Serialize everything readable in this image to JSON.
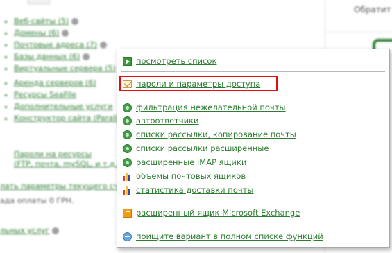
{
  "background": {
    "right_text": "Обратит",
    "list_items": [
      "Веб-сайты (5)",
      "Домены (6)",
      "Почтовые адреса (7)",
      "Базы данных (6)",
      "Виртуальные сервера (5)",
      "Аренда серверов (6)",
      "Ресурсы SeaFile",
      "Дополнительные услуги",
      "Конструктор сайта (Parallels)"
    ],
    "sub_link": "Пароли на ресурсы\n(FTP, почта, mySQL, и т.д.)",
    "settings_link": "лать параметры текущего счета",
    "payment_text": "ада оплаты 0 ГРН.",
    "services_link": "льных услуг"
  },
  "menu": {
    "items": [
      {
        "label": "посмотреть список",
        "icon": "arrow-right-icon"
      },
      {
        "label": "пароли и параметры доступа",
        "icon": "envelope-key-icon"
      },
      {
        "label": "фильтрация нежелательной почты",
        "icon": "green-circle-icon"
      },
      {
        "label": "автоответчики",
        "icon": "green-circle-icon"
      },
      {
        "label": "списки рассылки, копирование почты",
        "icon": "green-circle-icon"
      },
      {
        "label": "списки рассылки расширенные",
        "icon": "green-circle-icon"
      },
      {
        "label": "расширенные IMAP ящики",
        "icon": "green-circle-icon"
      },
      {
        "label": "объемы почтовых ящиков",
        "icon": "bar-chart-icon"
      },
      {
        "label": "статистика доставки почты",
        "icon": "bar-chart-icon"
      },
      {
        "label": "расширенный ящик Microsoft Exchange",
        "icon": "exchange-icon"
      },
      {
        "label": "поищите вариант в полном списке функций",
        "icon": "globe-icon"
      }
    ]
  },
  "colors": {
    "link_green": "#2e7d32",
    "highlight_red": "#e01010",
    "menu_border": "#a8a8a8"
  }
}
